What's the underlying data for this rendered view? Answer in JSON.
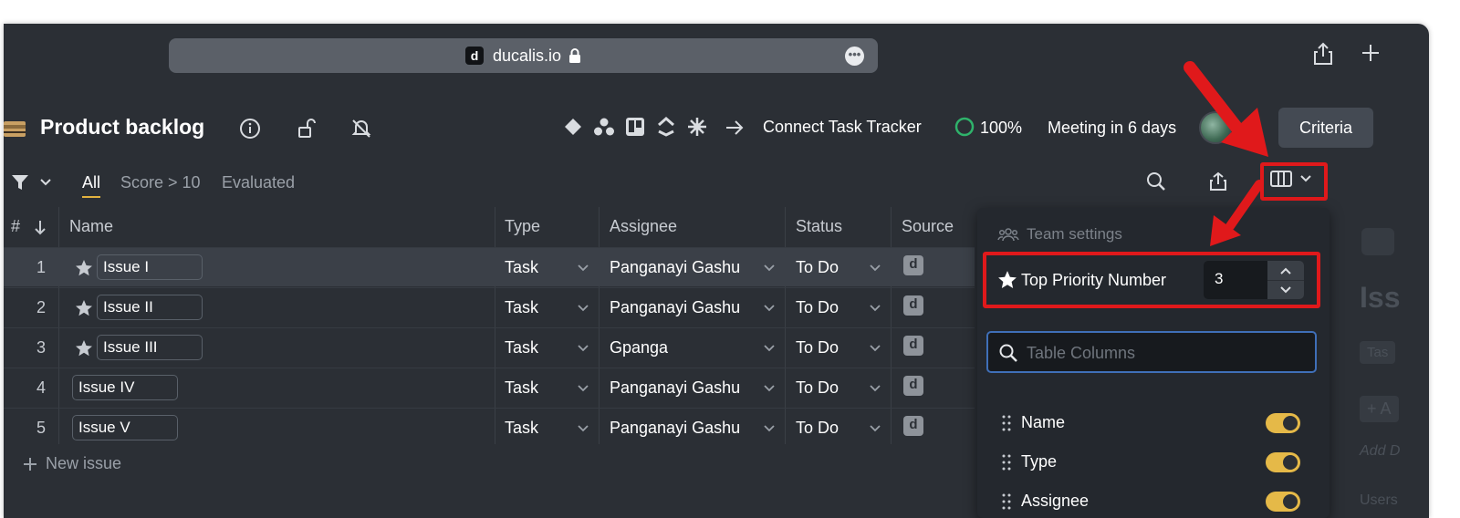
{
  "browser": {
    "favicon_letter": "d",
    "domain": "ducalis.io",
    "more_glyph": "•••"
  },
  "header": {
    "title": "Product backlog",
    "connect_label": "Connect Task Tracker",
    "progress": "100%",
    "meeting": "Meeting in 6 days",
    "criteria_label": "Criteria"
  },
  "filters": {
    "tabs": [
      "All",
      "Score > 10",
      "Evaluated"
    ]
  },
  "table": {
    "headers": {
      "num": "#",
      "name": "Name",
      "type": "Type",
      "assignee": "Assignee",
      "status": "Status",
      "source": "Source"
    },
    "rows": [
      {
        "num": "1",
        "name": "Issue I",
        "type": "Task",
        "assignee": "Panganayi Gashu",
        "status": "To Do",
        "source": "d"
      },
      {
        "num": "2",
        "name": "Issue II",
        "type": "Task",
        "assignee": "Panganayi Gashu",
        "status": "To Do",
        "source": "d"
      },
      {
        "num": "3",
        "name": "Issue III",
        "type": "Task",
        "assignee": "Gpanga",
        "status": "To Do",
        "source": "d"
      },
      {
        "num": "4",
        "name": "Issue IV",
        "type": "Task",
        "assignee": "Panganayi Gashu",
        "status": "To Do",
        "source": "d"
      },
      {
        "num": "5",
        "name": "Issue V",
        "type": "Task",
        "assignee": "Panganayi Gashu",
        "status": "To Do",
        "source": "d"
      }
    ],
    "new_issue": "New issue"
  },
  "columns_panel": {
    "team_settings": "Team settings",
    "top_priority_label": "Top Priority Number",
    "top_priority_value": "3",
    "search_placeholder": "Table Columns",
    "columns": [
      {
        "label": "Name",
        "enabled": true
      },
      {
        "label": "Type",
        "enabled": true
      },
      {
        "label": "Assignee",
        "enabled": true
      }
    ]
  },
  "side_ghost": {
    "issue_prefix": "Iss",
    "tag": "Tas",
    "add": "+ A",
    "add_desc": "Add D",
    "users": "Users"
  },
  "colors": {
    "background": "#2b2f35",
    "accent_yellow": "#e5b948",
    "annotation_red": "#e0191b",
    "progress_green": "#2fb36b",
    "focus_blue": "#3f6fb8"
  }
}
